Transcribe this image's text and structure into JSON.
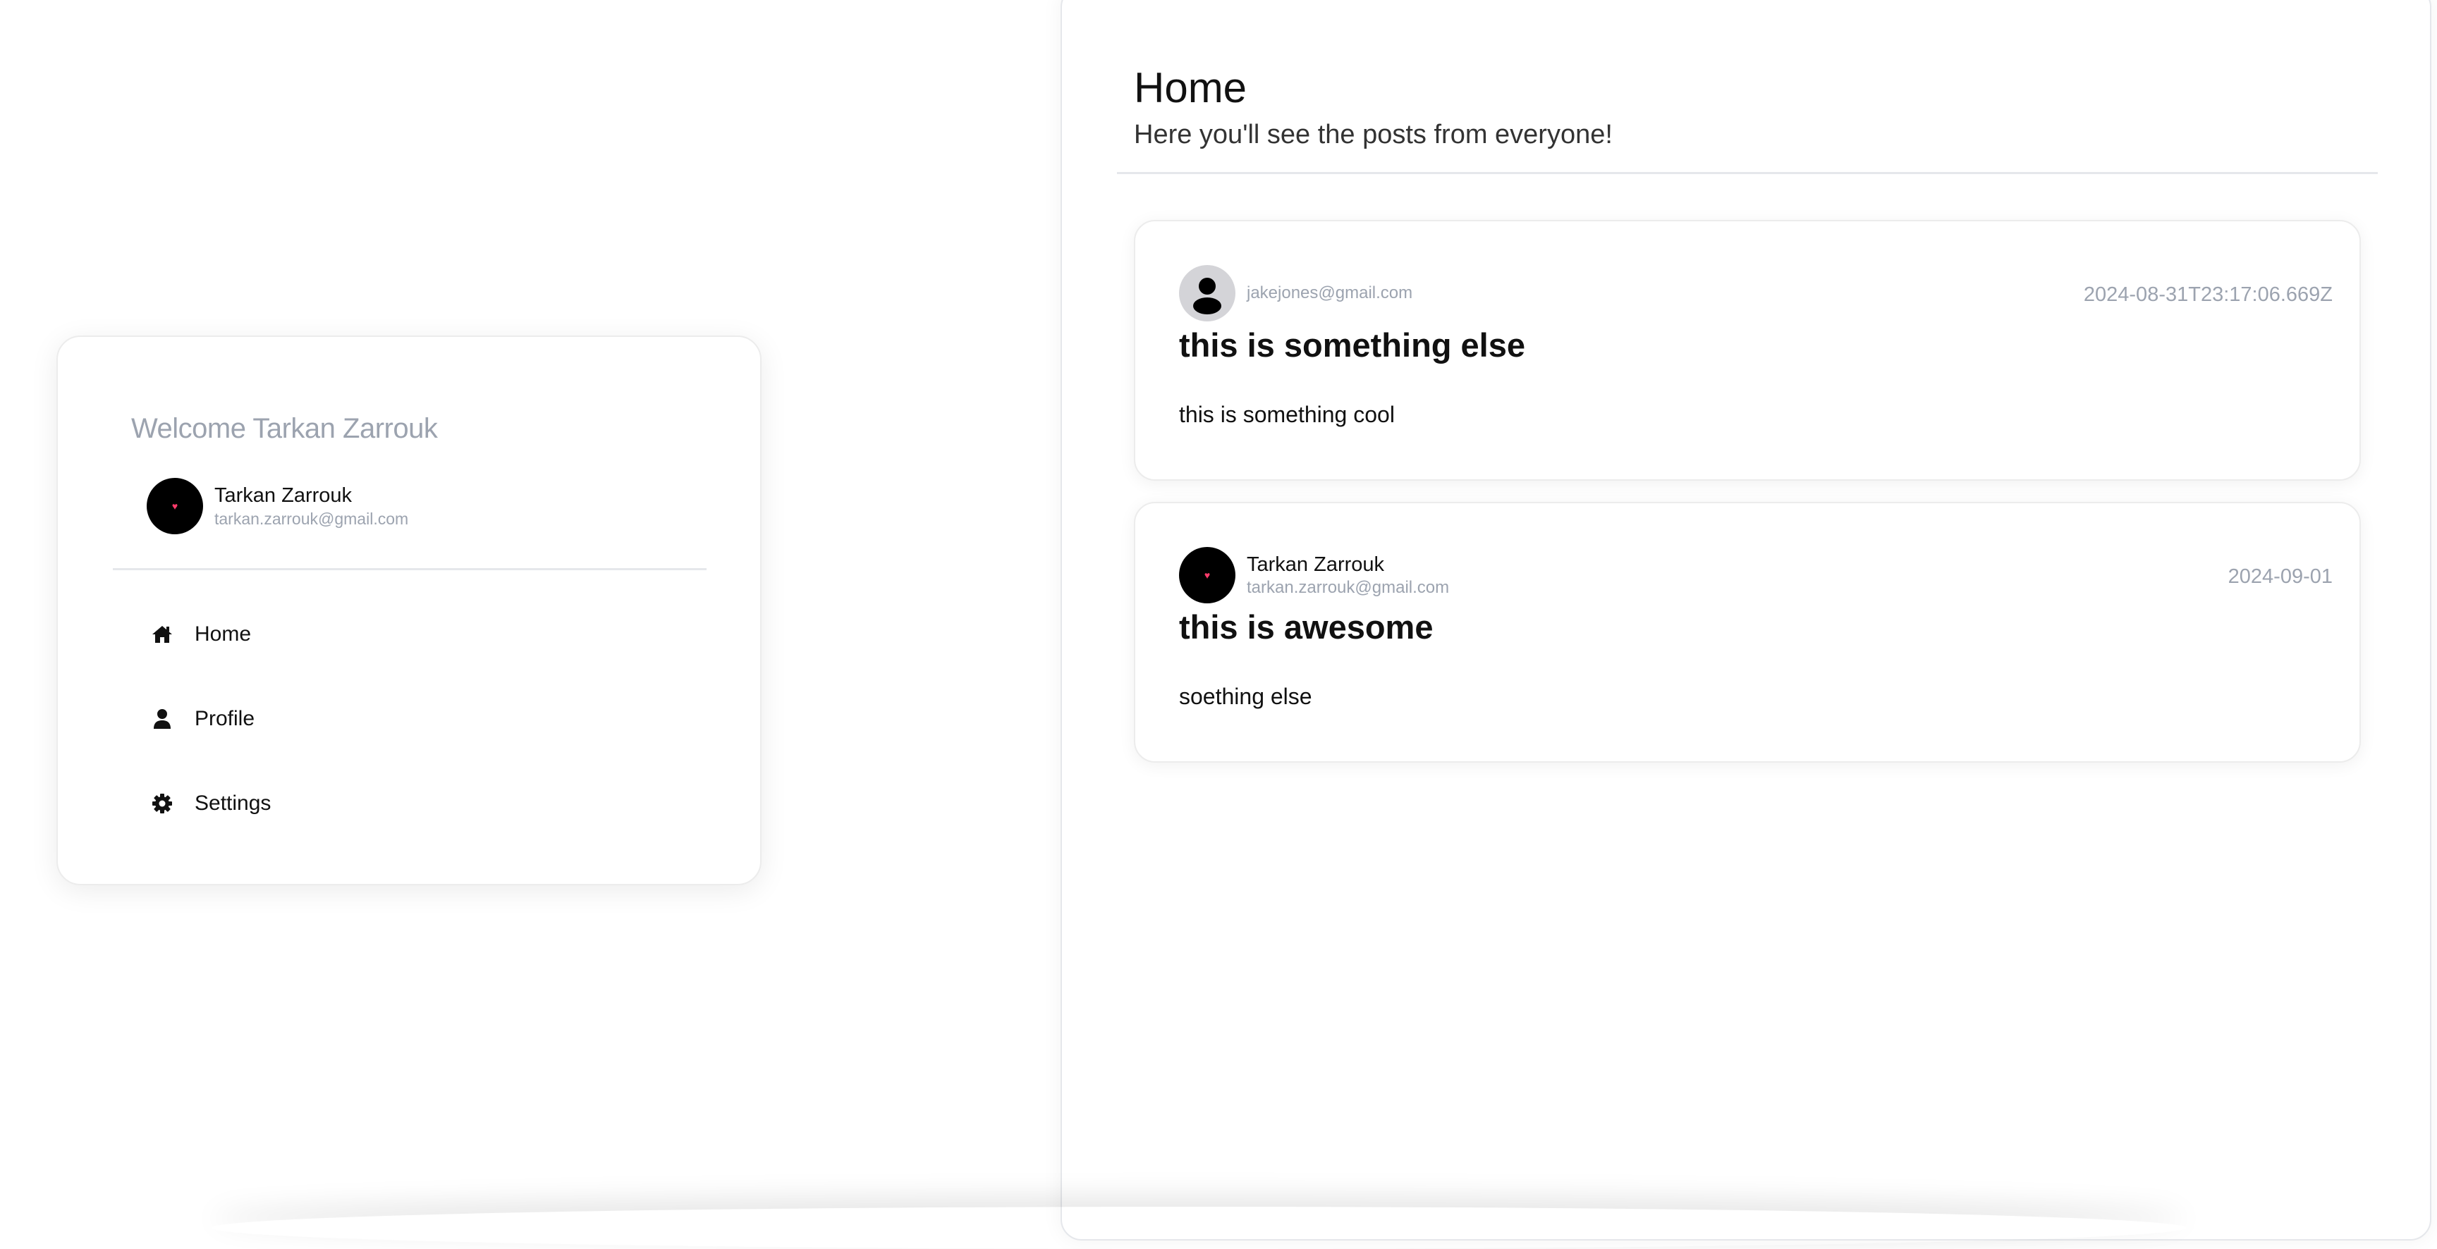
{
  "sidebar": {
    "welcome": "Welcome Tarkan Zarrouk",
    "user": {
      "name": "Tarkan Zarrouk",
      "email": "tarkan.zarrouk@gmail.com"
    },
    "nav": [
      {
        "label": "Home",
        "icon": "home-icon"
      },
      {
        "label": "Profile",
        "icon": "user-icon"
      },
      {
        "label": "Settings",
        "icon": "gear-icon"
      }
    ]
  },
  "main": {
    "title": "Home",
    "subtitle": "Here you'll see the posts from everyone!",
    "posts": [
      {
        "author_name": "",
        "author_email": "jakejones@gmail.com",
        "avatar": "default-user-avatar",
        "date": "2024-08-31T23:17:06.669Z",
        "title": "this is something else",
        "body": "this is something cool"
      },
      {
        "author_name": "Tarkan Zarrouk",
        "author_email": "tarkan.zarrouk@gmail.com",
        "avatar": "black-avatar",
        "date": "2024-09-01",
        "title": "this is awesome",
        "body": "soething else"
      }
    ]
  },
  "colors": {
    "muted_text": "#9ca3af",
    "divider": "#e5e7eb",
    "avatar_dark": "#000000",
    "avatar_default": "#d4d4d8"
  }
}
